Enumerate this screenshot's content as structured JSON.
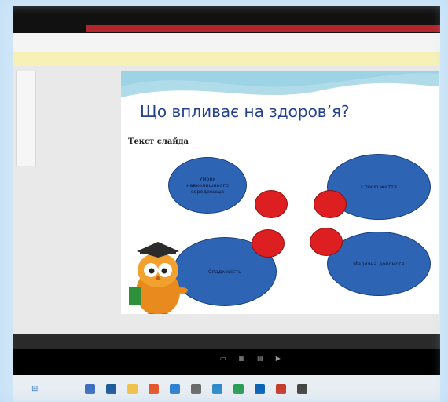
{
  "slide": {
    "title": "Що впливає на здоров’я?",
    "subtitle": "Текст слайда",
    "ellipses": [
      {
        "label": "Умови навколишнього середовища"
      },
      {
        "label": "Спосіб життя"
      },
      {
        "label": "Спадковість"
      },
      {
        "label": "Медична допомога"
      }
    ]
  },
  "icons": {
    "owl": "owl-teacher-icon",
    "start": "windows-start-icon"
  },
  "colors": {
    "ellipse_fill": "#2e64b4",
    "red_oval": "#dd1f22",
    "title": "#25428e",
    "title_bar_red": "#b3242b",
    "warning_bar": "#f7f1b8"
  }
}
